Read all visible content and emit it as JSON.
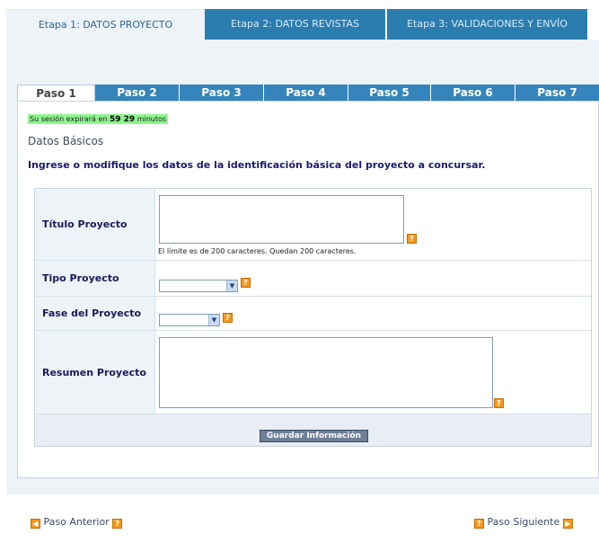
{
  "stages": [
    {
      "label": "Etapa 1: DATOS PROYECTO"
    },
    {
      "label": "Etapa 2: DATOS REVISTAS"
    },
    {
      "label": "Etapa 3: VALIDACIONES Y ENVÍO"
    }
  ],
  "steps": [
    {
      "label": "Paso 1"
    },
    {
      "label": "Paso 2"
    },
    {
      "label": "Paso 3"
    },
    {
      "label": "Paso 4"
    },
    {
      "label": "Paso 5"
    },
    {
      "label": "Paso 6"
    },
    {
      "label": "Paso 7"
    }
  ],
  "session": {
    "prefix": "Su sesión expirará en",
    "time": "59 29",
    "suffix": "minutos"
  },
  "section_title": "Datos Básicos",
  "intro": "Ingrese o modifique los datos de la identificación básica del proyecto a concursar.",
  "form": {
    "titulo_label": "Título Proyecto",
    "titulo_value": "",
    "limit_text": "El límite es de 200 caracteres. Quedan 200   caracteres.",
    "tipo_label": "Tipo Proyecto",
    "tipo_value": "",
    "fase_label": "Fase del Proyecto",
    "fase_value": "",
    "resumen_label": "Resumen Proyecto",
    "resumen_value": "",
    "save_label": "Guardar Información"
  },
  "nav": {
    "prev_label": "Paso Anterior",
    "next_label": "Paso Siguiente"
  },
  "icons": {
    "help": "help-icon",
    "arrow_left": "arrow-left-icon",
    "arrow_right": "arrow-right-icon",
    "dropdown": "chevron-down-icon"
  },
  "colors": {
    "tab_blue": "#2b7db0",
    "step_blue": "#3584bb",
    "help_orange": "#f29a20",
    "session_green": "#8ef58e"
  }
}
